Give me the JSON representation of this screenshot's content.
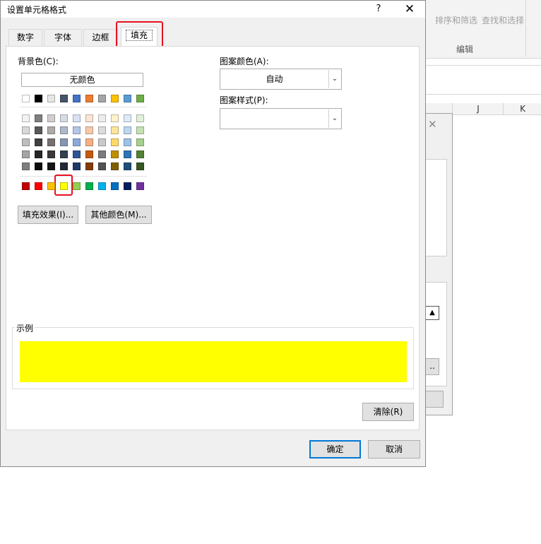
{
  "dialog": {
    "title": "设置单元格格式",
    "help": "?",
    "close": "✕",
    "tabs": [
      "数字",
      "字体",
      "边框",
      "填充"
    ],
    "active_tab": "填充"
  },
  "fill": {
    "background_color_label": "背景色(C):",
    "no_color_label": "无颜色",
    "fill_effects_label": "填充效果(I)...",
    "more_colors_label": "其他颜色(M)...",
    "pattern_color_label": "图案颜色(A):",
    "pattern_color_value": "自动",
    "pattern_style_label": "图案样式(P):",
    "pattern_style_value": "",
    "sample_label": "示例",
    "sample_color": "#FFFF00",
    "clear_label": "清除(R)",
    "selected_color": "#FFFF00"
  },
  "palette": {
    "theme_row": [
      "#FFFFFF",
      "#000000",
      "#E7E6E6",
      "#44546A",
      "#4472C4",
      "#ED7D31",
      "#A5A5A5",
      "#FFC000",
      "#5B9BD5",
      "#70AD47"
    ],
    "tint_rows": [
      [
        "#F2F2F2",
        "#7F7F7F",
        "#D0CECE",
        "#D6DCE4",
        "#D9E2F3",
        "#FBE5D5",
        "#EDEDED",
        "#FFF2CC",
        "#DDEBF7",
        "#E2EFD9"
      ],
      [
        "#D8D8D8",
        "#595959",
        "#AEAAAA",
        "#ADB9CA",
        "#B4C6E7",
        "#F7CAAC",
        "#DBDBDB",
        "#FEE599",
        "#BDD7EE",
        "#C5E0B3"
      ],
      [
        "#BFBFBF",
        "#3F3F3F",
        "#757171",
        "#8496B0",
        "#8EAADB",
        "#F4B183",
        "#C9C9C9",
        "#FFD965",
        "#9CC3E5",
        "#A8D08D"
      ],
      [
        "#A5A5A5",
        "#262626",
        "#3A3838",
        "#323F4F",
        "#2F5496",
        "#C55A11",
        "#7B7B7B",
        "#BF8F00",
        "#2E75B5",
        "#538135"
      ],
      [
        "#7F7F7F",
        "#0C0C0C",
        "#171616",
        "#222A35",
        "#1F3864",
        "#833C0B",
        "#525252",
        "#7F6000",
        "#1E4E79",
        "#375623"
      ]
    ],
    "standard_row": [
      "#C00000",
      "#FF0000",
      "#FFC000",
      "#FFFF00",
      "#92D050",
      "#00B050",
      "#00B0F0",
      "#0070C0",
      "#002060",
      "#7030A0"
    ]
  },
  "footer": {
    "ok_label": "确定",
    "cancel_label": "取消"
  },
  "background_app": {
    "sort_filter_label": "排序和筛选",
    "find_select_label": "查找和选择",
    "group_label": "编辑",
    "col_j": "J",
    "col_k": "K"
  }
}
